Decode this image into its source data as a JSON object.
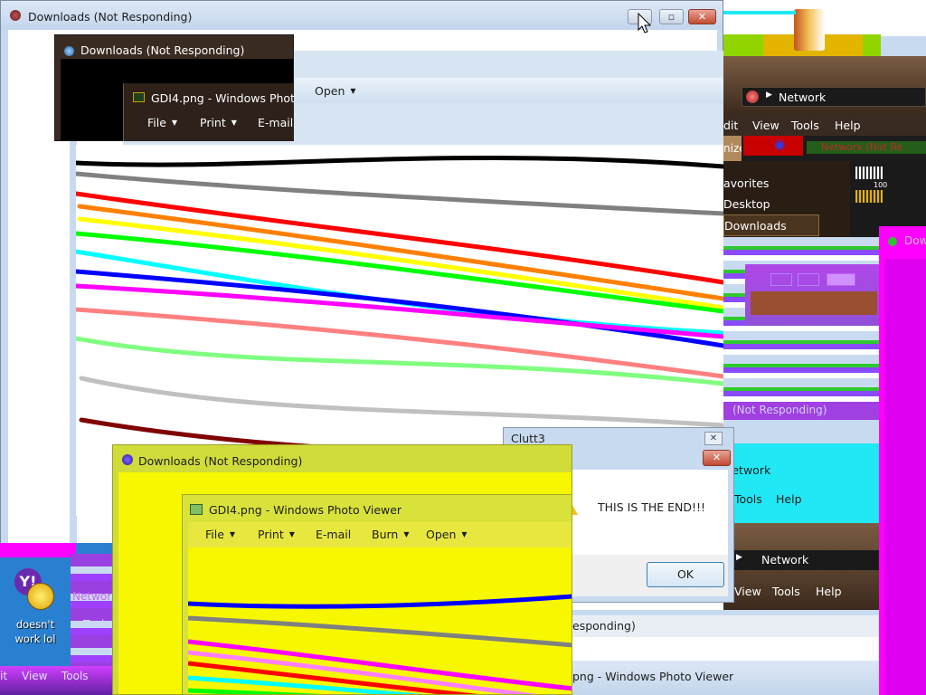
{
  "colors": {
    "aero_blue": "#c8daf0",
    "dark_brown": "#3a2b22",
    "yellow": "#f7f700",
    "yellow_green": "#cfdc3a",
    "magenta": "#ff00ff",
    "cyan": "#20e8f4",
    "green": "#2ec92e",
    "photo_toolbar": "#d7e4f2"
  },
  "background_window": {
    "title": "Downloads (Not Responding)",
    "icon": "downloads-folder-icon"
  },
  "ghost_window_dark": {
    "title": "Downloads (Not Responding)",
    "icon": "downloads-folder-icon"
  },
  "photo_viewer_top": {
    "title": "GDI4.png - Windows Photo",
    "menu": [
      "File",
      "Print",
      "E-mail"
    ],
    "open_label": "Open",
    "icon": "photo-viewer-icon"
  },
  "lines_chart": {
    "type": "line",
    "series_colors": [
      "#000000",
      "#808080",
      "#ff0000",
      "#ff8000",
      "#ffff00",
      "#00ff00",
      "#00ffff",
      "#0000ff",
      "#ff00ff",
      "#ff8080",
      "#80ff80",
      "#c0c0c0",
      "#800000"
    ]
  },
  "right_explorer": {
    "address": "Network",
    "menu": [
      "dit",
      "View",
      "Tools",
      "Help"
    ],
    "organize_fragment": "nize",
    "nav_items": [
      "avorites",
      "Desktop",
      "Downloads"
    ],
    "thumb_label": "100",
    "ghost_title": "Network (Not Re"
  },
  "right_column": {
    "magenta_title": "Dow",
    "not_responding_fragment": "(Not Responding)",
    "address_2": "Network",
    "menu_2": [
      "Tools",
      "Help"
    ],
    "address_3": "Network",
    "menu_3": [
      "View",
      "Tools",
      "Help"
    ],
    "responding_fragment": "esponding)",
    "photo_fragment": "png - Windows Photo Viewer"
  },
  "clutt_dialog": {
    "title": "Clutt3",
    "message": "THIS IS THE END!!!",
    "ok_label": "OK"
  },
  "front_yellow_window": {
    "title": "Downloads (Not Responding)",
    "icon": "downloads-folder-icon"
  },
  "front_photo_viewer": {
    "title": "GDI4.png - Windows Photo Viewer",
    "menu": [
      "File",
      "Print",
      "E-mail",
      "Burn",
      "Open"
    ],
    "icon": "photo-viewer-icon"
  },
  "desktop": {
    "icon_label_line1": "doesn't",
    "icon_label_line2": "work lol",
    "icon_name": "yahoo-messenger-icon",
    "strip_fragments": [
      "Networ",
      "Tools",
      "it",
      "View",
      "Tools"
    ]
  }
}
